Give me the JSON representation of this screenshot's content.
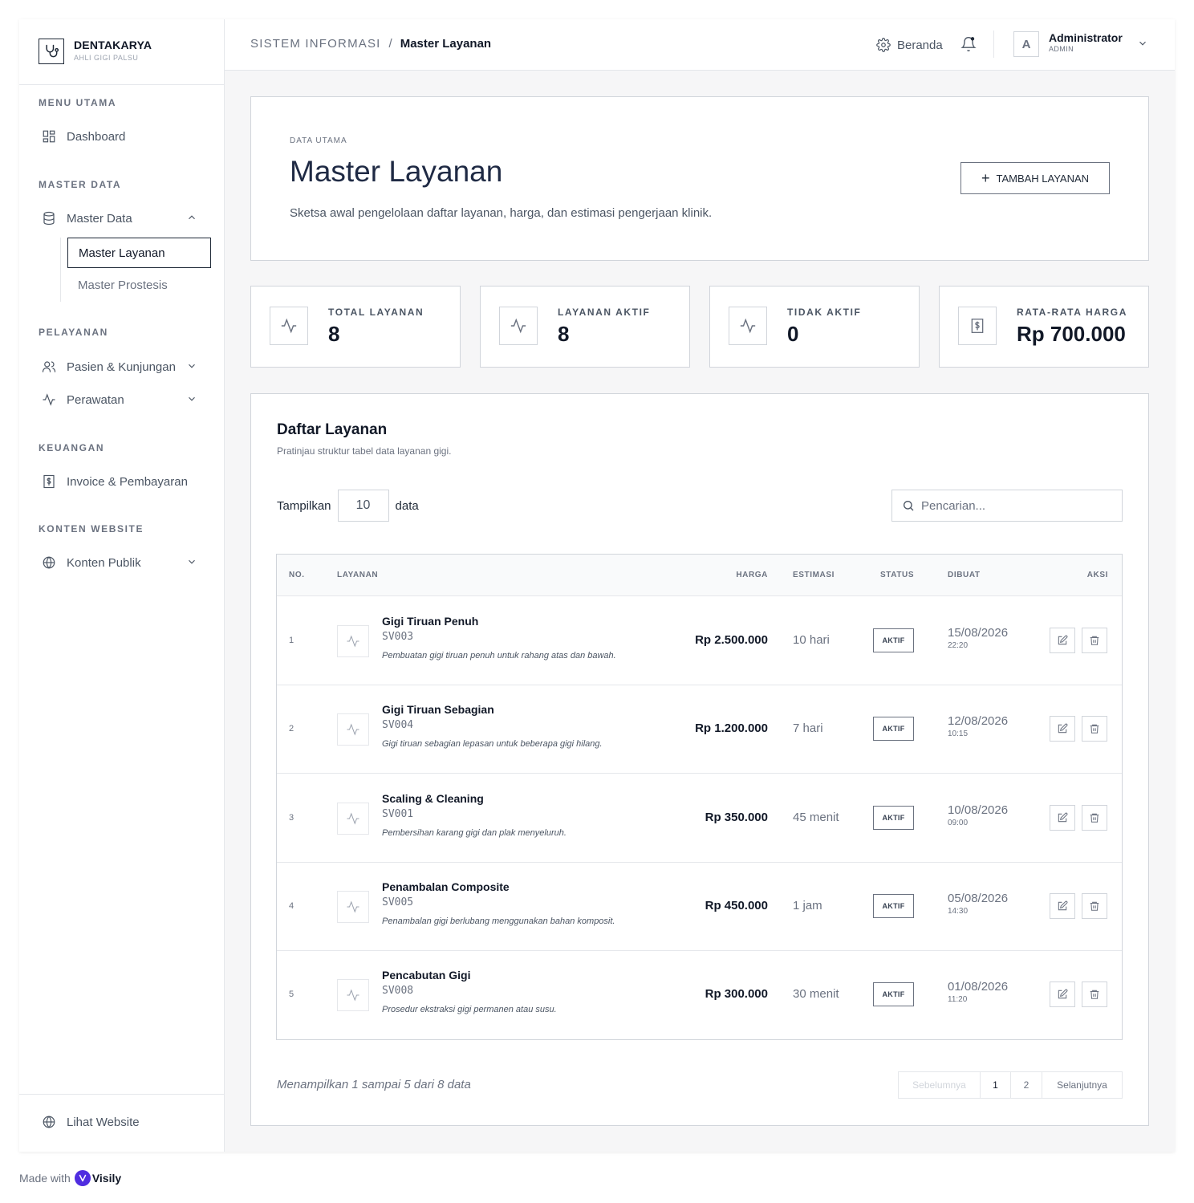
{
  "brand": {
    "name": "DENTAKARYA",
    "subtitle": "AHLI GIGI PALSU"
  },
  "sidebar": {
    "sections": [
      {
        "title": "MENU UTAMA"
      },
      {
        "title": "MASTER DATA"
      },
      {
        "title": "PELAYANAN"
      },
      {
        "title": "KEUANGAN"
      },
      {
        "title": "KONTEN WEBSITE"
      }
    ],
    "items": {
      "dashboard": "Dashboard",
      "master_data": "Master Data",
      "master_layanan": "Master Layanan",
      "master_prostesis": "Master Prostesis",
      "pasien": "Pasien & Kunjungan",
      "perawatan": "Perawatan",
      "invoice": "Invoice & Pembayaran",
      "konten": "Konten Publik"
    },
    "bottom_link": "Lihat Website"
  },
  "header": {
    "crumb_root": "SISTEM INFORMASI",
    "crumb_sep": "/",
    "crumb_current": "Master Layanan",
    "home_label": "Beranda",
    "avatar_letter": "A",
    "user_name": "Administrator",
    "user_role": "ADMIN"
  },
  "hero": {
    "overline": "DATA UTAMA",
    "title": "Master Layanan",
    "description": "Sketsa awal pengelolaan daftar layanan, harga, dan estimasi pengerjaan klinik.",
    "add_button": "TAMBAH LAYANAN"
  },
  "stats": [
    {
      "label": "TOTAL LAYANAN",
      "value": "8",
      "icon": "activity-icon"
    },
    {
      "label": "LAYANAN AKTIF",
      "value": "8",
      "icon": "activity-icon"
    },
    {
      "label": "TIDAK AKTIF",
      "value": "0",
      "icon": "activity-icon"
    },
    {
      "label": "RATA-RATA HARGA",
      "value": "Rp 700.000",
      "icon": "receipt-icon"
    }
  ],
  "list": {
    "title": "Daftar Layanan",
    "subtitle": "Pratinjau struktur tabel data layanan gigi.",
    "show_prefix": "Tampilkan",
    "show_value": "10",
    "show_suffix": "data",
    "search_placeholder": "Pencarian...",
    "columns": {
      "no": "NO.",
      "layanan": "LAYANAN",
      "harga": "HARGA",
      "estimasi": "ESTIMASI",
      "status": "STATUS",
      "dibuat": "DIBUAT",
      "aksi": "AKSI"
    },
    "rows": [
      {
        "no": "1",
        "name": "Gigi Tiruan Penuh",
        "code": "SV003",
        "desc": "Pembuatan gigi tiruan penuh untuk rahang atas dan bawah.",
        "price": "Rp 2.500.000",
        "est": "10 hari",
        "status": "AKTIF",
        "date": "15/08/2026",
        "time": "22:20"
      },
      {
        "no": "2",
        "name": "Gigi Tiruan Sebagian",
        "code": "SV004",
        "desc": "Gigi tiruan sebagian lepasan untuk beberapa gigi hilang.",
        "price": "Rp 1.200.000",
        "est": "7 hari",
        "status": "AKTIF",
        "date": "12/08/2026",
        "time": "10:15"
      },
      {
        "no": "3",
        "name": "Scaling & Cleaning",
        "code": "SV001",
        "desc": "Pembersihan karang gigi dan plak menyeluruh.",
        "price": "Rp 350.000",
        "est": "45 menit",
        "status": "AKTIF",
        "date": "10/08/2026",
        "time": "09:00"
      },
      {
        "no": "4",
        "name": "Penambalan Composite",
        "code": "SV005",
        "desc": "Penambalan gigi berlubang menggunakan bahan komposit.",
        "price": "Rp 450.000",
        "est": "1 jam",
        "status": "AKTIF",
        "date": "05/08/2026",
        "time": "14:30"
      },
      {
        "no": "5",
        "name": "Pencabutan Gigi",
        "code": "SV008",
        "desc": "Prosedur ekstraksi gigi permanen atau susu.",
        "price": "Rp 300.000",
        "est": "30 menit",
        "status": "AKTIF",
        "date": "01/08/2026",
        "time": "11:20"
      }
    ],
    "footer_text": "Menampilkan 1 sampai 5 dari 8 data",
    "pager": {
      "prev": "Sebelumnya",
      "p1": "1",
      "p2": "2",
      "next": "Selanjutnya"
    }
  },
  "made_with": {
    "prefix": "Made with",
    "brand": "Visily"
  }
}
